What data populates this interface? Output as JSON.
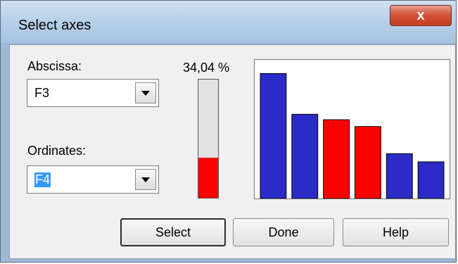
{
  "window": {
    "title": "Select axes",
    "close_label": "x"
  },
  "abscissa": {
    "label": "Abscissa:",
    "value": "F3"
  },
  "ordinates": {
    "label": "Ordinates:",
    "value": "F4"
  },
  "gauge": {
    "percent_text": "34,04 %",
    "fill_fraction": 0.34
  },
  "chart_data": {
    "type": "bar",
    "values": [
      92,
      62,
      58,
      53,
      33,
      27
    ],
    "colors": [
      "#2b2bc8",
      "#2b2bc8",
      "#ff0000",
      "#ff0000",
      "#2b2bc8",
      "#2b2bc8"
    ],
    "ylim": [
      0,
      100
    ]
  },
  "buttons": {
    "select": "Select",
    "done": "Done",
    "help": "Help"
  }
}
